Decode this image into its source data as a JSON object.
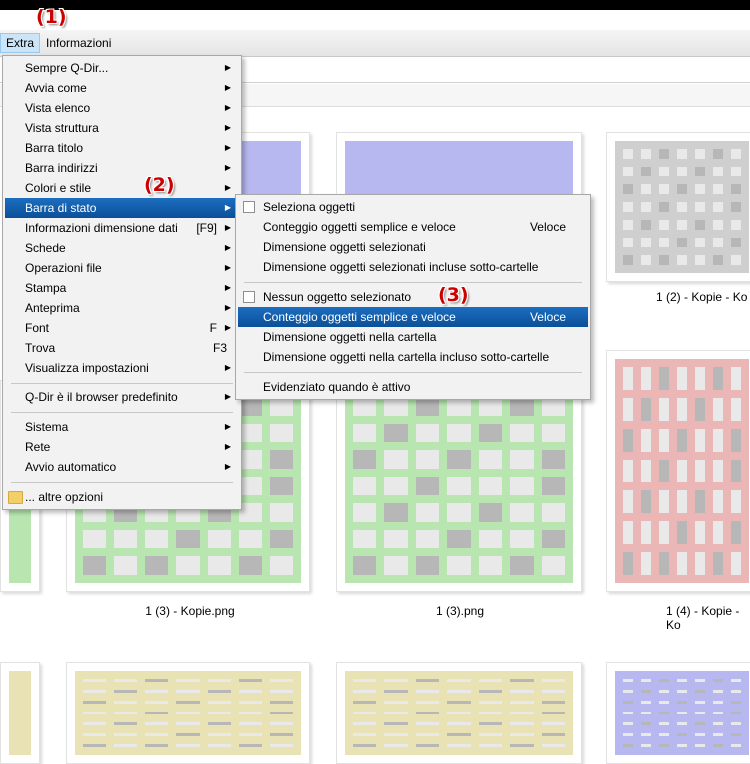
{
  "menubar": {
    "extra": "Extra",
    "informazioni": "Informazioni"
  },
  "annotations": {
    "a1": "(1)",
    "a2": "(2)",
    "a3": "(3)"
  },
  "extra_menu": {
    "items": [
      {
        "label": "Sempre Q-Dir...",
        "shortcut": "",
        "submenu": true
      },
      {
        "label": "Avvia come",
        "shortcut": "",
        "submenu": true
      },
      {
        "label": "Vista elenco",
        "shortcut": "",
        "submenu": true
      },
      {
        "label": "Vista struttura",
        "shortcut": "",
        "submenu": true
      },
      {
        "label": "Barra titolo",
        "shortcut": "",
        "submenu": true
      },
      {
        "label": "Barra indirizzi",
        "shortcut": "",
        "submenu": true
      },
      {
        "label": "Colori e stile",
        "shortcut": "",
        "submenu": true
      },
      {
        "label": "Barra di stato",
        "shortcut": "",
        "submenu": true,
        "highlighted": true
      },
      {
        "label": "Informazioni dimensione dati",
        "shortcut": "[F9]",
        "submenu": true
      },
      {
        "label": "Schede",
        "shortcut": "",
        "submenu": true
      },
      {
        "label": "Operazioni file",
        "shortcut": "",
        "submenu": true
      },
      {
        "label": "Stampa",
        "shortcut": "",
        "submenu": true
      },
      {
        "label": "Anteprima",
        "shortcut": "",
        "submenu": true
      },
      {
        "label": "Font",
        "shortcut": "F",
        "submenu": true
      },
      {
        "label": "Trova",
        "shortcut": "F3",
        "submenu": false
      },
      {
        "label": "Visualizza impostazioni",
        "shortcut": "",
        "submenu": true
      },
      {
        "label": "Q-Dir è il browser predefinito",
        "shortcut": "",
        "submenu": true
      },
      {
        "label": "Sistema",
        "shortcut": "",
        "submenu": true
      },
      {
        "label": "Rete",
        "shortcut": "",
        "submenu": true
      },
      {
        "label": "Avvio automatico",
        "shortcut": "",
        "submenu": true
      },
      {
        "label": "... altre opzioni",
        "shortcut": "",
        "submenu": false
      }
    ]
  },
  "status_submenu": {
    "items": [
      {
        "label": "Seleziona oggetti",
        "shortcut": "",
        "checkbox": true
      },
      {
        "label": "Conteggio oggetti semplice e veloce",
        "shortcut": "Veloce"
      },
      {
        "label": "Dimensione oggetti selezionati",
        "shortcut": ""
      },
      {
        "label": "Dimensione oggetti selezionati incluse sotto-cartelle",
        "shortcut": ""
      },
      {
        "label": "Nessun oggetto selezionato",
        "shortcut": "",
        "checkbox": true
      },
      {
        "label": "Conteggio oggetti semplice e veloce",
        "shortcut": "Veloce",
        "highlighted": true
      },
      {
        "label": "Dimensione oggetti nella cartella",
        "shortcut": ""
      },
      {
        "label": "Dimensione oggetti nella cartella incluso sotto-cartelle",
        "shortcut": ""
      },
      {
        "label": "Evidenziato quando è attivo",
        "shortcut": ""
      }
    ]
  },
  "captions": {
    "c1": "1 (2) - Kopie - Ko",
    "c2": "1 (3) - Kopie.png",
    "c3": "1 (3).png",
    "c4": "1 (4) - Kopie - Ko"
  },
  "colors": {
    "highlight": "#0b4f98",
    "annotation": "#cc0000"
  }
}
